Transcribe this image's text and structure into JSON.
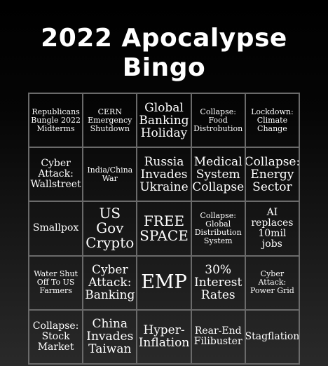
{
  "title": {
    "line1": "2022 Apocalypse",
    "line2": "Bingo"
  },
  "cells": [
    "Republicans\nBungle 2022\nMidterms",
    "CERN\nEmergency\nShutdown",
    "Global\nBanking\nHoliday",
    "Collapse:\nFood\nDistrobution",
    "Lockdown:\nClimate\nChange",
    "Cyber\nAttack:\nWallstreet",
    "India/China\nWar",
    "Russia\nInvades\nUkraine",
    "Medical\nSystem\nCollapse",
    "Collapse:\nEnergy\nSector",
    "Smallpox",
    "US Gov\nCrypto",
    "FREE\nSPACE",
    "Collapse:\nGlobal\nDistribution\nSystem",
    "AI\nreplaces\n10mil jobs",
    "Water Shut\nOff To US\nFarmers",
    "Cyber\nAttack:\nBanking",
    "EMP",
    "30%\nInterest\nRates",
    "Cyber\nAttack:\nPower Grid",
    "Collapse:\nStock\nMarket",
    "China\nInvades\nTaiwan",
    "Hyper-\nInflation",
    "Rear-End\nFilibuster",
    "Stagflation"
  ]
}
